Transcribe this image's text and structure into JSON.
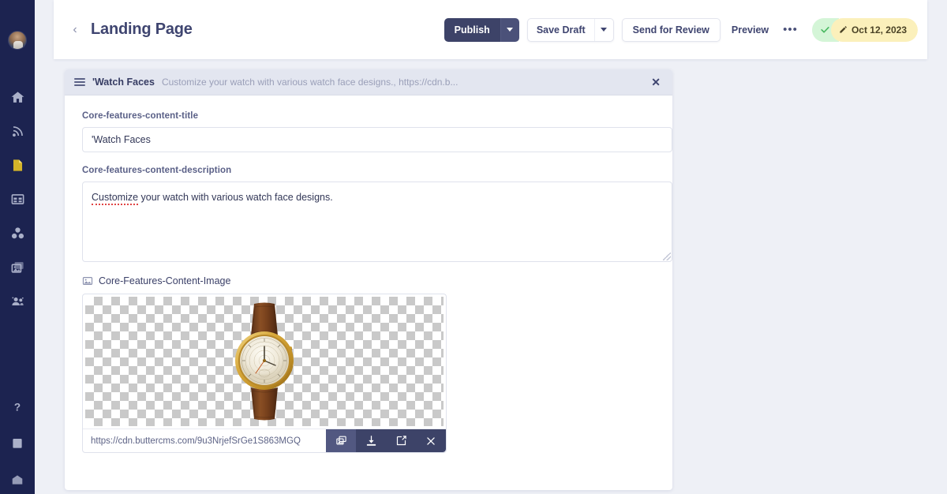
{
  "sidebar": {
    "avatar_name": "user-avatar",
    "items": [
      {
        "name": "home-icon",
        "label": "Home",
        "active": false
      },
      {
        "name": "blog-icon",
        "label": "Blog",
        "active": false
      },
      {
        "name": "pages-icon",
        "label": "Pages",
        "active": true
      },
      {
        "name": "collections-icon",
        "label": "Collections",
        "active": false
      },
      {
        "name": "components-icon",
        "label": "Components",
        "active": false
      },
      {
        "name": "media-icon",
        "label": "Media",
        "active": false
      },
      {
        "name": "team-icon",
        "label": "Team",
        "active": false
      }
    ],
    "bottom_items": [
      {
        "name": "help-icon",
        "label": "Help"
      },
      {
        "name": "docs-icon",
        "label": "Docs"
      },
      {
        "name": "settings-icon",
        "label": "Settings"
      }
    ]
  },
  "header": {
    "back_label": "‹",
    "title": "Landing Page",
    "publish_label": "Publish",
    "save_draft_label": "Save Draft",
    "send_for_review_label": "Send for Review",
    "preview_label": "Preview",
    "more_label": "•••",
    "status": {
      "check_glyph": "✓",
      "pencil_glyph": "✎",
      "date": "Oct 12, 2023"
    }
  },
  "component": {
    "header_title": "'Watch Faces",
    "header_subtitle": "Customize your watch with various watch face designs., https://cdn.b...",
    "close_glyph": "✕",
    "fields": {
      "title": {
        "label": "Core-features-content-title",
        "value": "'Watch Faces",
        "placeholder": ""
      },
      "description": {
        "label": "Core-features-content-description",
        "value_misspelled": "Customize",
        "value_rest": " your watch with various watch face designs.",
        "placeholder": ""
      },
      "image": {
        "label": "Core-Features-Content-Image",
        "url": "https://cdn.buttercms.com/9u3NrjefSrGe1S863MGQ",
        "actions": [
          {
            "name": "replace-image-button",
            "glyph": "image"
          },
          {
            "name": "download-image-button",
            "glyph": "download"
          },
          {
            "name": "edit-image-button",
            "glyph": "edit"
          },
          {
            "name": "remove-image-button",
            "glyph": "close"
          }
        ]
      }
    }
  },
  "colors": {
    "sidebar_bg": "#1c2350",
    "primary": "#3d4368",
    "accent_yellow": "#d4b429",
    "page_bg": "#eef0f6",
    "status_green": "#d4f5d7",
    "status_yellow": "#fbf0bb"
  }
}
